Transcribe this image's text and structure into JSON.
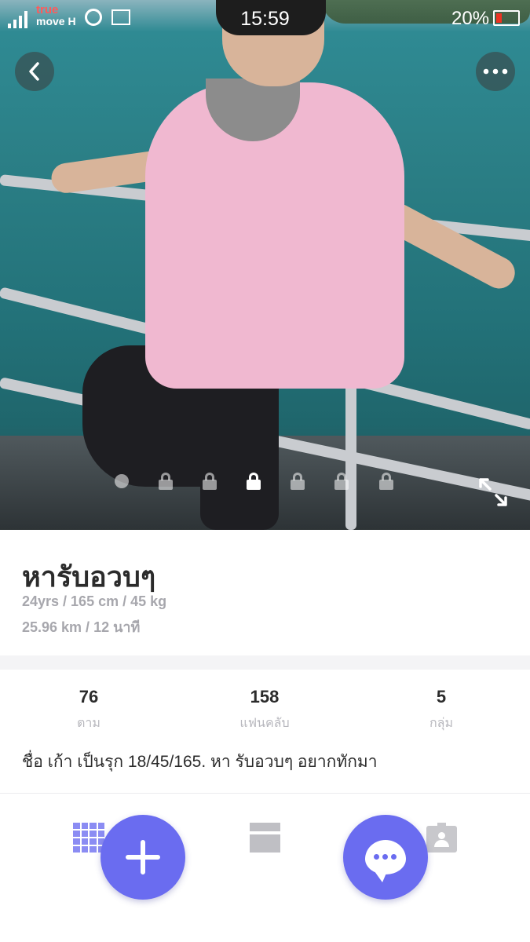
{
  "status_bar": {
    "carrier_line1": "true",
    "carrier_line2": "move H",
    "time": "15:59",
    "battery_percent": "20%"
  },
  "photo": {
    "current_index": 3,
    "total": 7
  },
  "profile": {
    "name": "หารับอวบๆ",
    "stats_line": "24yrs / 165 cm / 45 kg",
    "distance_line": "25.96 km / 12 นาที",
    "bio": "ชื่อ เก้า เป็นรุก 18/45/165. หา รับอวบๆ อยากทักมา"
  },
  "stats": [
    {
      "value": "76",
      "label": "ตาม"
    },
    {
      "value": "158",
      "label": "แฟนคลับ"
    },
    {
      "value": "5",
      "label": "กลุ่ม"
    }
  ],
  "icons": {
    "back": "chevron-left-icon",
    "more": "more-dots-icon",
    "expand": "expand-icon",
    "grid_tab": "grid-icon",
    "feed_tab": "card-icon",
    "group_tab": "contact-icon",
    "add": "plus-icon",
    "chat": "chat-bubble-icon"
  },
  "colors": {
    "accent": "#6a6cf0",
    "text": "#2b2b2b",
    "muted": "#a7a7ad"
  }
}
